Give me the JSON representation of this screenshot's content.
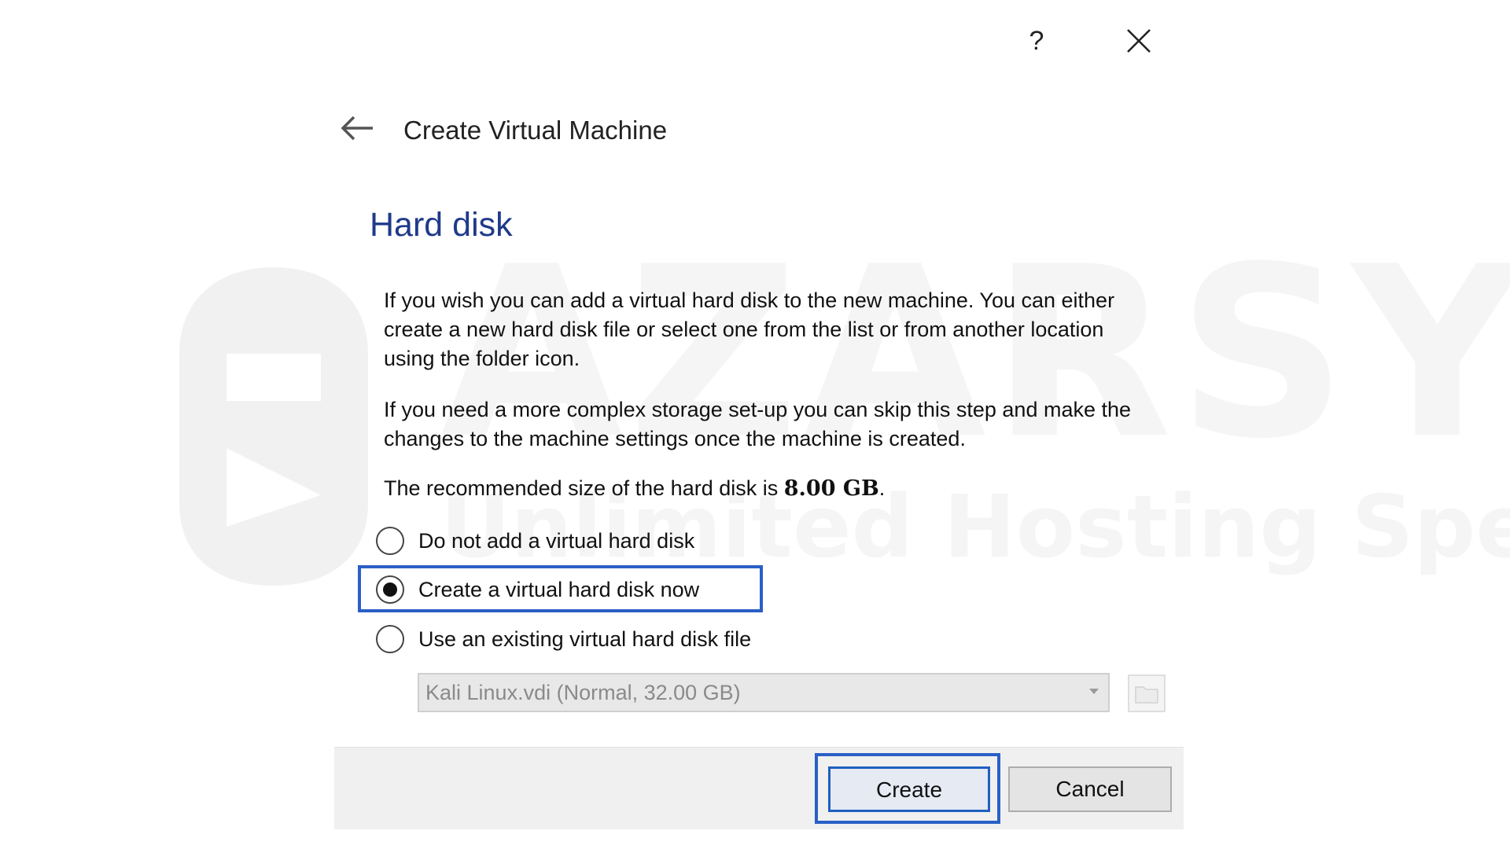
{
  "watermark": {
    "brand": "AZARSYS",
    "tagline": "Unlimited Hosting Speed"
  },
  "window": {
    "title": "Create Virtual Machine",
    "help_label": "?",
    "icons": {
      "back": "arrow-left-icon",
      "close": "close-icon",
      "folder": "folder-icon",
      "dropdown": "chevron-down-icon"
    }
  },
  "page": {
    "heading": "Hard disk",
    "paragraph1": "If you wish you can add a virtual hard disk to the new machine. You can either create a new hard disk file or select one from the list or from another location using the folder icon.",
    "paragraph2": "If you need a more complex storage set-up you can skip this step and make the changes to the machine settings once the machine is created.",
    "recommended_prefix": "The recommended size of the hard disk is ",
    "recommended_size": "8.00 GB",
    "recommended_suffix": "."
  },
  "options": [
    {
      "label": "Do not add a virtual hard disk",
      "selected": false
    },
    {
      "label": "Create a virtual hard disk now",
      "selected": true
    },
    {
      "label": "Use an existing virtual hard disk file",
      "selected": false
    }
  ],
  "disk_select": {
    "value": "Kali Linux.vdi (Normal, 32.00 GB)",
    "enabled": false
  },
  "buttons": {
    "create": "Create",
    "cancel": "Cancel"
  },
  "colors": {
    "heading": "#1f3a8a",
    "highlight": "#2a5fc6",
    "footer_bg": "#f0f0f0"
  }
}
